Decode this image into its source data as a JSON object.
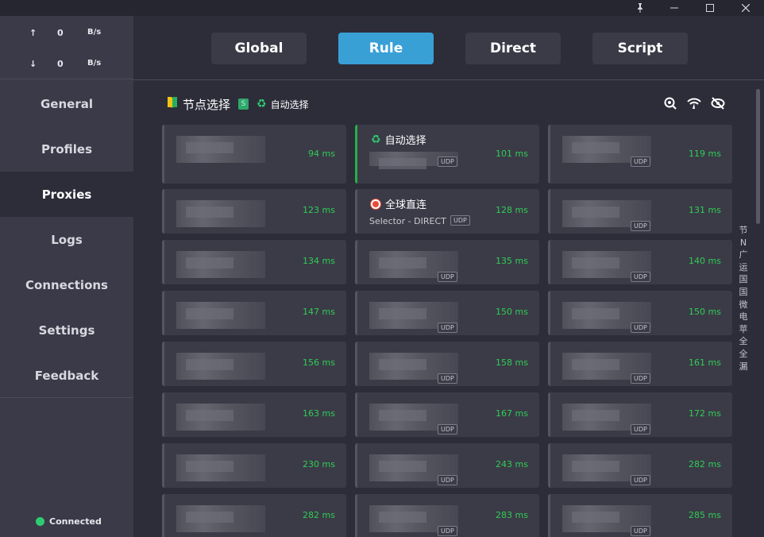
{
  "traffic": {
    "up": {
      "arrow": "↑",
      "value": "0",
      "unit": "B/s"
    },
    "down": {
      "arrow": "↓",
      "value": "0",
      "unit": "B/s"
    }
  },
  "nav": [
    {
      "label": "General"
    },
    {
      "label": "Profiles"
    },
    {
      "label": "Proxies",
      "active": true
    },
    {
      "label": "Logs"
    },
    {
      "label": "Connections"
    },
    {
      "label": "Settings"
    },
    {
      "label": "Feedback"
    }
  ],
  "status": {
    "label": "Connected",
    "color": "#2ecc71"
  },
  "modes": [
    {
      "label": "Global"
    },
    {
      "label": "Rule",
      "active": true
    },
    {
      "label": "Direct"
    },
    {
      "label": "Script"
    }
  ],
  "colors": {
    "accent": "#39a0d6",
    "delay": "#2fcc55",
    "selected_bar": "#25b04a"
  },
  "group": {
    "icon": "beginner-badge-icon",
    "title": "节点选择",
    "badge": "S",
    "selected": "自动选择",
    "selected_icon": "recycle-icon"
  },
  "head_icons": [
    "search-zoom-icon",
    "wifi-speed-icon",
    "eye-off-icon"
  ],
  "proxies": [
    [
      "94 ms",
      "101 ms",
      "119 ms"
    ],
    [
      "123 ms",
      "128 ms",
      "131 ms"
    ],
    [
      "134 ms",
      "135 ms",
      "140 ms"
    ],
    [
      "147 ms",
      "150 ms",
      "150 ms"
    ],
    [
      "156 ms",
      "158 ms",
      "161 ms"
    ],
    [
      "163 ms",
      "167 ms",
      "172 ms"
    ],
    [
      "230 ms",
      "243 ms",
      "282 ms"
    ],
    [
      "282 ms",
      "283 ms",
      "285 ms"
    ]
  ],
  "special_cards": {
    "auto": {
      "title": "自动选择"
    },
    "global": {
      "title": "全球直连",
      "subtitle": "Selector - DIRECT"
    }
  },
  "udp_label": "UDP",
  "index_letters": [
    "节",
    "N",
    "广",
    "运",
    "国",
    "国",
    "微",
    "电",
    "苹",
    "全",
    "全",
    "漏"
  ]
}
